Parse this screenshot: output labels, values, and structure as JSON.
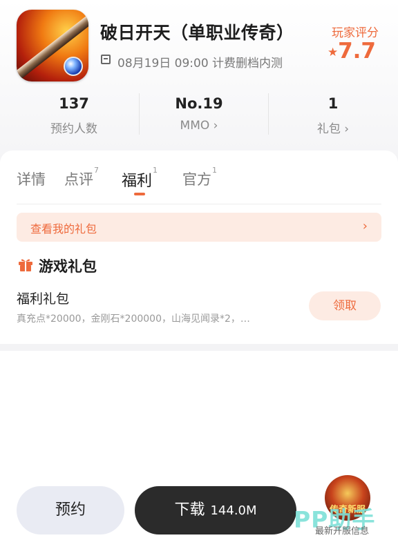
{
  "app": {
    "title": "破日开天（单职业传奇）",
    "subtitle": "08月19日 09:00 计费删档内测",
    "rating_label": "玩家评分",
    "rating_value": "7.7",
    "icon": "game-app-icon"
  },
  "stats": [
    {
      "value": "137",
      "label": "预约人数"
    },
    {
      "value": "No.19",
      "label": "MMO ›"
    },
    {
      "value": "1",
      "label": "礼包 ›"
    }
  ],
  "tabs": [
    {
      "label": "详情",
      "badge": ""
    },
    {
      "label": "点评",
      "badge": "7"
    },
    {
      "label": "福利",
      "badge": "1"
    },
    {
      "label": "官方",
      "badge": "1"
    }
  ],
  "active_tab": "福利",
  "banner": {
    "text": "查看我的礼包",
    "chevron": "›"
  },
  "gifts": {
    "section_title": "游戏礼包",
    "items": [
      {
        "name": "福利礼包",
        "desc": "真充点*20000，金刚石*200000，山海见闻录*2，…",
        "button": "领取"
      }
    ]
  },
  "bottom": {
    "reserve_label": "预约",
    "download_label": "下载",
    "download_size": "144.0M",
    "floating_badge": "传奇新服",
    "watermark": "PP助手",
    "caption": "最新开服信息"
  },
  "colors": {
    "accent": "#ee6a3c",
    "accent_light": "#fdebe3",
    "dark_button": "#2b2b2b"
  }
}
